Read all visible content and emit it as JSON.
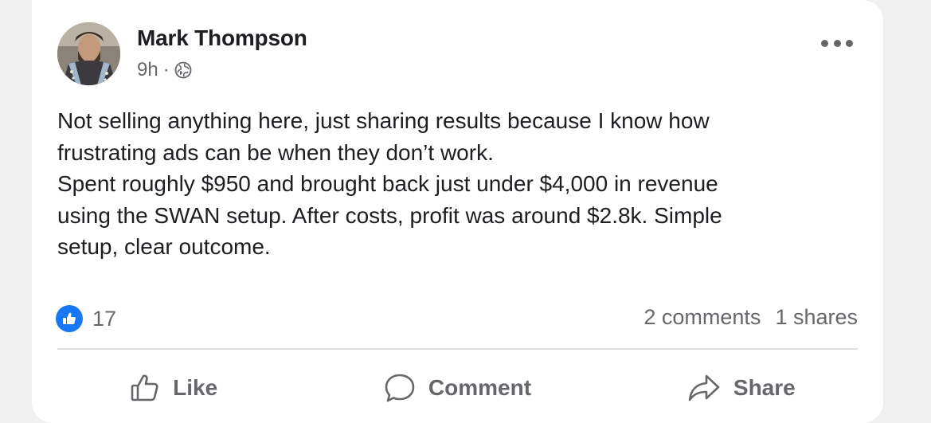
{
  "post": {
    "author": "Mark Thompson",
    "time": "9h",
    "separator": "·",
    "audience_icon": "globe-icon",
    "more_icon": "more-options-icon",
    "text_lines": [
      "Not selling anything here, just sharing results because I know how",
      "frustrating ads can be when they don’t work.",
      "Spent roughly $950 and brought back just under $4,000 in revenue",
      "using the SWAN setup. After costs, profit was around $2.8k. Simple",
      "setup, clear outcome."
    ]
  },
  "engagement": {
    "reaction_icon": "like-reaction-icon",
    "reaction_count": "17",
    "comments": "2 comments",
    "shares": "1 shares"
  },
  "actions": {
    "like_label": "Like",
    "comment_label": "Comment",
    "share_label": "Share"
  },
  "colors": {
    "accent": "#1877f2",
    "text": "#1c1e21",
    "muted": "#65676b"
  }
}
